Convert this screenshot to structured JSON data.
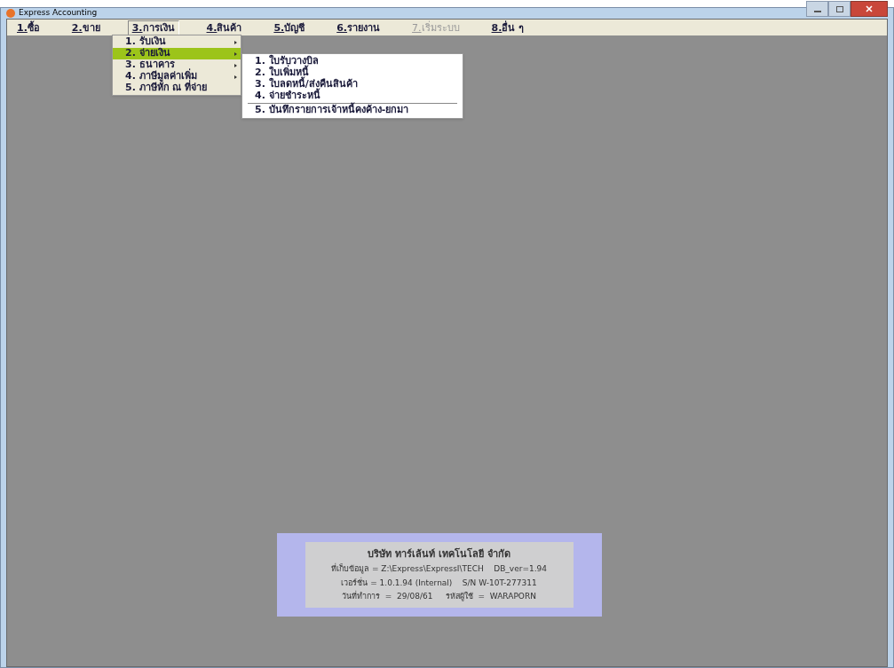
{
  "window": {
    "title": "Express Accounting"
  },
  "menu_bar": [
    {
      "label": "1.ซื้อ",
      "selected": false,
      "disabled": false
    },
    {
      "label": "2.ขาย",
      "selected": false,
      "disabled": false
    },
    {
      "label": "3.การเงิน",
      "selected": true,
      "disabled": false
    },
    {
      "label": "4.สินค้า",
      "selected": false,
      "disabled": false
    },
    {
      "label": "5.บัญชี",
      "selected": false,
      "disabled": false
    },
    {
      "label": "6.รายงาน",
      "selected": false,
      "disabled": false
    },
    {
      "label": "7.เริ่มระบบ",
      "selected": false,
      "disabled": true
    },
    {
      "label": "8.อื่น ๆ",
      "selected": false,
      "disabled": false
    }
  ],
  "dropdown": [
    {
      "label": "1. รับเงิน",
      "submenu": true,
      "selected": false
    },
    {
      "label": "2. จ่ายเงิน",
      "submenu": true,
      "selected": true
    },
    {
      "label": "3. ธนาคาร",
      "submenu": true,
      "selected": false
    },
    {
      "label": "4. ภาษีมูลค่าเพิ่ม",
      "submenu": true,
      "selected": false
    },
    {
      "label": "5. ภาษีหัก ณ ที่จ่าย",
      "submenu": false,
      "selected": false
    }
  ],
  "submenu": [
    {
      "label": "1. ใบรับวางบิล",
      "separator_before": false
    },
    {
      "label": "2. ใบเพิ่มหนี้",
      "separator_before": false
    },
    {
      "label": "3. ใบลดหนี้/ส่งคืนสินค้า",
      "separator_before": false
    },
    {
      "label": "4. จ่ายชำระหนี้",
      "separator_before": false
    },
    {
      "label": "5. บันทึกรายการเจ้าหนี้คงค้าง-ยกมา",
      "separator_before": true
    }
  ],
  "info_panel": {
    "company": "บริษัท ทาร์เล้นท์ เทคโนโลยี จำกัด",
    "lines": [
      "ที่เก็บข้อมูล = Z:\\Express\\ExpressI\\TECH    DB_ver=1.94",
      "เวอร์ชั่น = 1.0.1.94 (Internal)    S/N W-10T-277311",
      "วันที่ทำการ  =  29/08/61     รหัสผู้ใช้  =  WARAPORN"
    ]
  }
}
